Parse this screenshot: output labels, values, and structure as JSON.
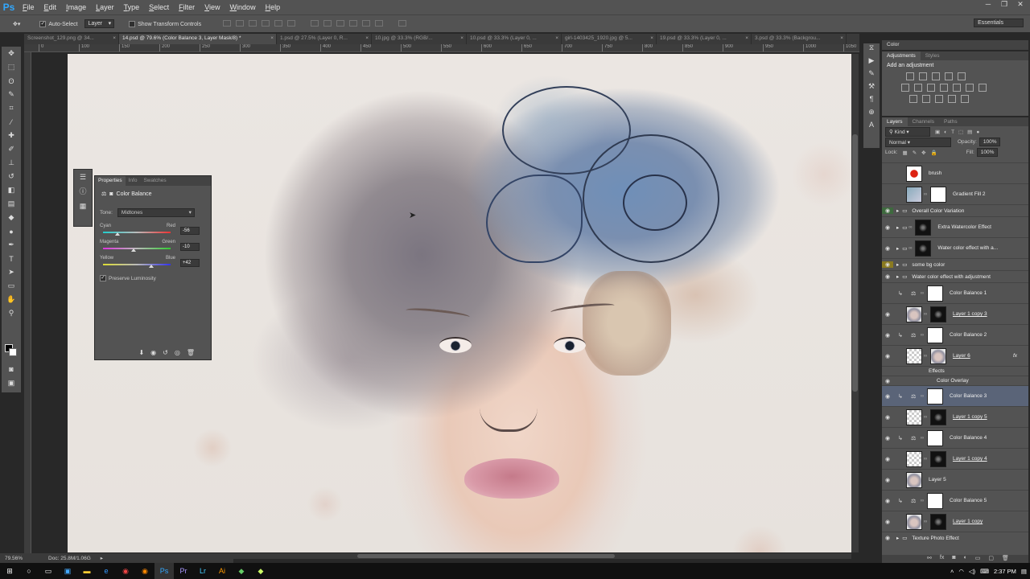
{
  "app": {
    "logo": "Ps"
  },
  "menu": [
    "File",
    "Edit",
    "Image",
    "Layer",
    "Type",
    "Select",
    "Filter",
    "View",
    "Window",
    "Help"
  ],
  "options": {
    "auto_select_label": "Auto-Select",
    "auto_select_mode": "Layer",
    "show_transform_label": "Show Transform Controls",
    "workspace": "Essentials"
  },
  "tabs": [
    {
      "label": "Screenshot_129.png @ 34...",
      "active": false
    },
    {
      "label": "14.psd @ 79.6% (Color Balance 3, Layer Mask/8) *",
      "active": true
    },
    {
      "label": "1.psd @ 27.5% (Layer 0, R...",
      "active": false
    },
    {
      "label": "10.jpg @ 33.3% (RGB/...",
      "active": false
    },
    {
      "label": "10.psd @ 33.3% (Layer 0, ...",
      "active": false
    },
    {
      "label": "girl-1403425_1920.jpg @ 5...",
      "active": false
    },
    {
      "label": "19.psd @ 33.3% (Layer 0, ...",
      "active": false
    },
    {
      "label": "3.psd @ 33.3% (Backgrou...",
      "active": false
    }
  ],
  "ruler_top": [
    "0",
    "100",
    "150",
    "200",
    "250",
    "300",
    "350",
    "400",
    "450",
    "500",
    "550",
    "600",
    "650",
    "700",
    "750",
    "800",
    "850",
    "900",
    "950",
    "1000",
    "1050",
    "1100",
    "1150"
  ],
  "status": {
    "zoom": "79.56%",
    "doc": "Doc: 25.8M/1.06G"
  },
  "properties": {
    "tabs": [
      "Properties",
      "Info",
      "Swatches"
    ],
    "title": "Color Balance",
    "tone_label": "Tone:",
    "tone_value": "Midtones",
    "sliders": [
      {
        "left": "Cyan",
        "right": "Red",
        "value": "-56",
        "pos": -56,
        "track": "linear-gradient(90deg,#2cc 0%,#bbb 50%,#e33 100%)"
      },
      {
        "left": "Magenta",
        "right": "Green",
        "value": "-10",
        "pos": -10,
        "track": "linear-gradient(90deg,#d3d 0%,#bbb 50%,#3c3 100%)"
      },
      {
        "left": "Yellow",
        "right": "Blue",
        "value": "+42",
        "pos": 42,
        "track": "linear-gradient(90deg,#dd3 0%,#bbb 50%,#33e 100%)"
      }
    ],
    "preserve_label": "Preserve Luminosity"
  },
  "color_panel": {
    "label": "Color"
  },
  "adjustments": {
    "tabs": [
      "Adjustments",
      "Styles"
    ],
    "header": "Add an adjustment"
  },
  "layers": {
    "tabs": [
      "Layers",
      "Channels",
      "Paths"
    ],
    "kind": "Kind",
    "blend": "Normal",
    "opacity_label": "Opacity:",
    "opacity": "100%",
    "lock_label": "Lock:",
    "fill_label": "Fill:",
    "fill": "100%",
    "items": [
      {
        "name": "brush",
        "type": "layer",
        "thumb": "t-red",
        "mask": "",
        "eye": "",
        "adj": false,
        "u": false
      },
      {
        "name": "Gradient Fill 2",
        "type": "layer",
        "thumb": "t-grad",
        "mask": "t-white",
        "eye": "",
        "adj": false,
        "u": false
      },
      {
        "name": "Overall Color Variation",
        "type": "group",
        "eye": "g"
      },
      {
        "name": "Extra Watercolor Effect",
        "type": "group-thumb",
        "mask": "t-dark",
        "eye": "on"
      },
      {
        "name": "Water color effect with a...",
        "type": "group-thumb",
        "mask": "t-dark",
        "eye": "on"
      },
      {
        "name": "some bg color",
        "type": "group",
        "eye": "y"
      },
      {
        "name": "Water color effect with adjustment",
        "type": "group",
        "eye": "on"
      },
      {
        "name": "Color Balance 1",
        "type": "layer",
        "thumb": "",
        "mask": "t-white",
        "eye": "",
        "adj": true,
        "u": false
      },
      {
        "name": "Layer 1 copy 3",
        "type": "layer",
        "thumb": "t-face",
        "mask": "t-dark",
        "eye": "on",
        "adj": false,
        "u": true
      },
      {
        "name": "Color Balance 2",
        "type": "layer",
        "thumb": "",
        "mask": "t-white",
        "eye": "on",
        "adj": true,
        "u": false
      },
      {
        "name": "Layer 6",
        "type": "layer",
        "thumb": "t-check",
        "mask": "t-face",
        "eye": "on",
        "adj": false,
        "u": true,
        "fx": "fx"
      },
      {
        "name": "Effects",
        "type": "sub"
      },
      {
        "name": "Color Overlay",
        "type": "sub"
      },
      {
        "name": "Color Balance 3",
        "type": "layer",
        "thumb": "",
        "mask": "t-white",
        "eye": "on",
        "adj": true,
        "u": false,
        "sel": true
      },
      {
        "name": "Layer 1 copy 5",
        "type": "layer",
        "thumb": "t-check",
        "mask": "t-dark",
        "eye": "on",
        "adj": false,
        "u": true
      },
      {
        "name": "Color Balance 4",
        "type": "layer",
        "thumb": "",
        "mask": "t-white",
        "eye": "on",
        "adj": true,
        "u": false
      },
      {
        "name": "Layer 1 copy 4",
        "type": "layer",
        "thumb": "t-check",
        "mask": "t-dark",
        "eye": "on",
        "adj": false,
        "u": true
      },
      {
        "name": "Layer 5",
        "type": "layer",
        "thumb": "t-face",
        "mask": "",
        "eye": "on",
        "adj": false,
        "u": false
      },
      {
        "name": "Color Balance 5",
        "type": "layer",
        "thumb": "",
        "mask": "t-white",
        "eye": "on",
        "adj": true,
        "u": false
      },
      {
        "name": "Layer 1 copy",
        "type": "layer",
        "thumb": "t-face",
        "mask": "t-dark",
        "eye": "on",
        "adj": false,
        "u": true
      },
      {
        "name": "Texture Photo Effect",
        "type": "group",
        "eye": "on"
      }
    ]
  },
  "taskbar": {
    "time": "2:37 PM"
  },
  "colors": {
    "accent": "#31a8ff",
    "panel": "#535353",
    "dark": "#3a3a3a"
  }
}
